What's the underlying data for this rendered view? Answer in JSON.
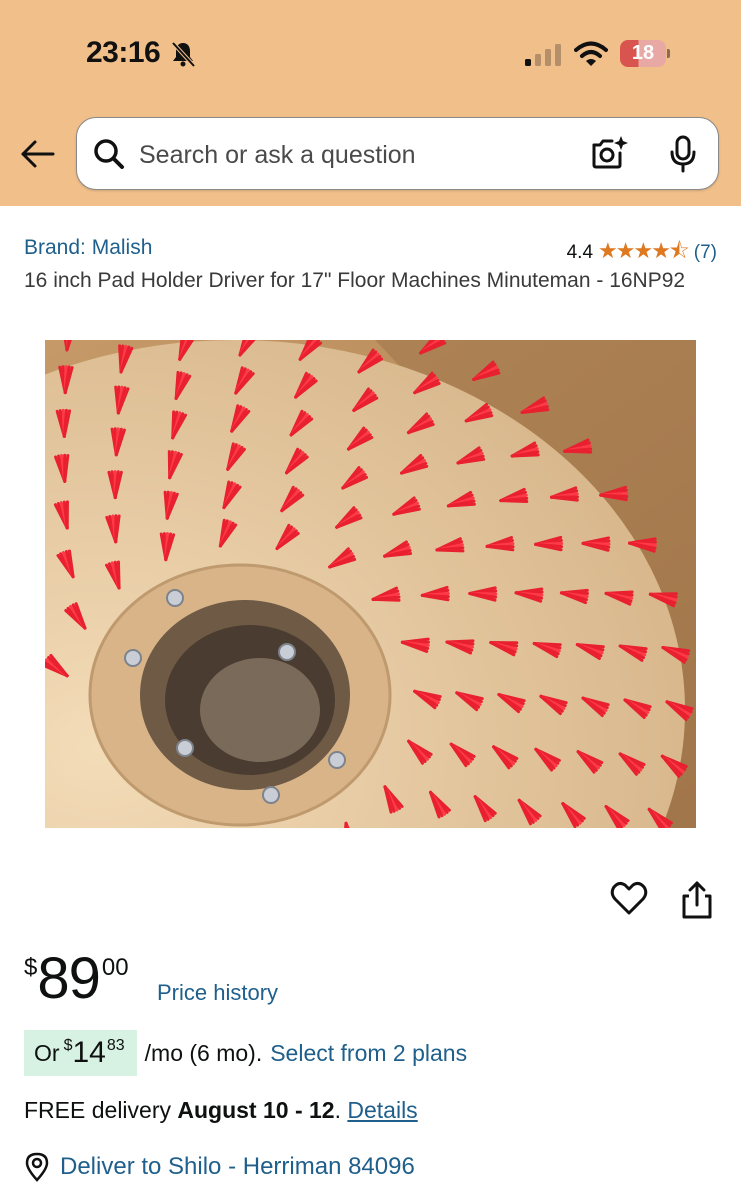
{
  "status_bar": {
    "time": "23:16",
    "battery_level": "18",
    "icons": [
      "bell-slash-icon",
      "signal-icon",
      "wifi-icon",
      "battery-icon"
    ]
  },
  "search": {
    "placeholder": "Search or ask a question",
    "icons": [
      "back-arrow-icon",
      "search-icon",
      "camera-lens-icon",
      "microphone-icon"
    ]
  },
  "product": {
    "brand": "Brand: Malish",
    "rating_value": "4.4",
    "stars": "★★★★⯪",
    "rating_count": "(7)",
    "title": "16 inch Pad Holder Driver for 17\" Floor Machines Minuteman - 16NP92",
    "image_alt": "Red bristle pad driver brush"
  },
  "actions": {
    "icons": [
      "heart-icon",
      "share-icon"
    ]
  },
  "price": {
    "symbol": "$",
    "whole": "89",
    "fraction": "00",
    "history_link": "Price history"
  },
  "financing": {
    "prefix": "Or",
    "symbol": "$",
    "whole": "14",
    "fraction": "83",
    "per": "/mo (6 mo).",
    "plans_link": "Select from 2 plans"
  },
  "delivery": {
    "prefix": "FREE delivery",
    "dates": "August 10 - 12",
    "suffix": ".",
    "details_link": "Details"
  },
  "deliver_to": {
    "text": "Deliver to Shilo - Herriman 84096"
  },
  "colors": {
    "header_bg": "#f0bf8a",
    "link": "#1f5f8b",
    "star": "#de7921",
    "financing_bg": "#d7f2e3"
  }
}
